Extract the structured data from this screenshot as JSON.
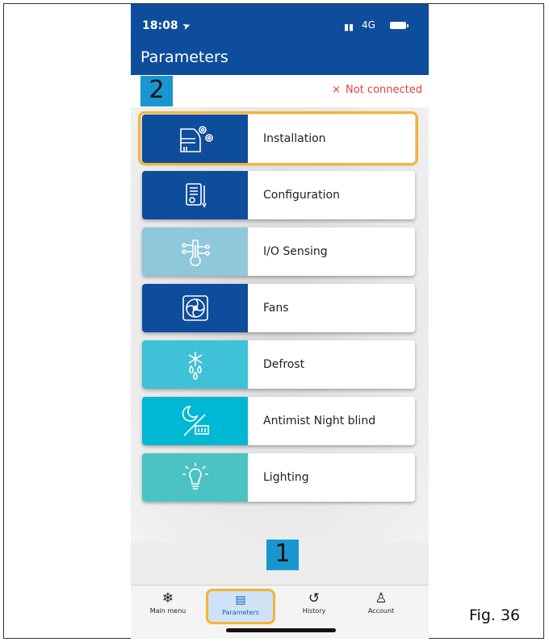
{
  "status_bar": {
    "time": "18:08",
    "network": "4G"
  },
  "header": {
    "title": "Parameters"
  },
  "connection": {
    "badge": "2",
    "status": "Not connected",
    "status_icon": "×"
  },
  "menu": {
    "items": [
      {
        "label": "Installation",
        "icon": "installation-icon",
        "color": "#0d4d9c"
      },
      {
        "label": "Configuration",
        "icon": "configuration-icon",
        "color": "#0d4d9c"
      },
      {
        "label": "I/O Sensing",
        "icon": "io-sensing-icon",
        "color": "#8fc7db"
      },
      {
        "label": "Fans",
        "icon": "fan-icon",
        "color": "#0d4d9c"
      },
      {
        "label": "Defrost",
        "icon": "defrost-icon",
        "color": "#3fc1d8"
      },
      {
        "label": "Antimist Night blind",
        "icon": "antimist-icon",
        "color": "#00b8d4"
      },
      {
        "label": "Lighting",
        "icon": "lightbulb-icon",
        "color": "#4cc3c3"
      }
    ]
  },
  "highlight_colors": {
    "border": "#f5b335",
    "badge": "#1996d0"
  },
  "bottom_badge": "1",
  "tabs": [
    {
      "label": "Main menu",
      "icon": "snowflake-icon"
    },
    {
      "label": "Parameters",
      "icon": "parameters-icon"
    },
    {
      "label": "History",
      "icon": "history-icon"
    },
    {
      "label": "Account",
      "icon": "account-icon"
    }
  ],
  "figure_label": "Fig. 36"
}
